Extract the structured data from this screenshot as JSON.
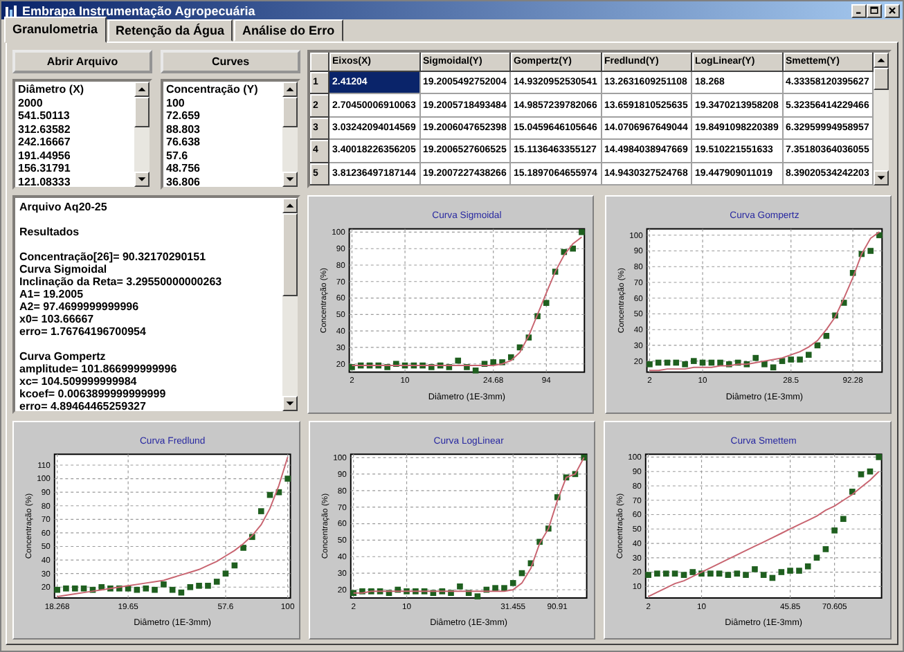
{
  "window": {
    "title": "Embrapa Instrumentação Agropecuária"
  },
  "tabs": [
    {
      "label": "Granulometria",
      "selected": true
    },
    {
      "label": "Retenção da Água",
      "selected": false
    },
    {
      "label": "Análise do Erro",
      "selected": false
    }
  ],
  "buttons": [
    "Abrir Arquivo",
    "Curves"
  ],
  "lists": [
    {
      "header": "Diâmetro (X)",
      "items": [
        "2000",
        "541.50113",
        "312.63582",
        "242.16667",
        "191.44956",
        "156.31791",
        "121.08333"
      ]
    },
    {
      "header": "Concentração (Y)",
      "items": [
        "100",
        "72.659",
        "88.803",
        "76.638",
        "57.6",
        "48.756",
        "36.806"
      ]
    }
  ],
  "table": {
    "columns": [
      "Eixos(X)",
      "Sigmoidal(Y)",
      "Gompertz(Y)",
      "Fredlund(Y)",
      "LogLinear(Y)",
      "Smettem(Y)"
    ],
    "rows": [
      {
        "label": "1",
        "cells": [
          {
            "text": "2.41204",
            "selected": true
          },
          {
            "text": "19.2005492752004",
            "selected": false
          },
          {
            "text": "14.9320952530541",
            "selected": false
          },
          {
            "text": "13.2631609251108",
            "selected": false
          },
          {
            "text": "18.268",
            "selected": false
          },
          {
            "text": "4.33358120395627",
            "selected": false
          }
        ]
      },
      {
        "label": "2",
        "cells": [
          {
            "text": "2.70450006910063",
            "selected": false
          },
          {
            "text": "19.2005718493484",
            "selected": false
          },
          {
            "text": "14.9857239782066",
            "selected": false
          },
          {
            "text": "13.6591810525635",
            "selected": false
          },
          {
            "text": "19.3470213958208",
            "selected": false
          },
          {
            "text": "5.32356414229466",
            "selected": false
          }
        ]
      },
      {
        "label": "3",
        "cells": [
          {
            "text": "3.03242094014569",
            "selected": false
          },
          {
            "text": "19.2006047652398",
            "selected": false
          },
          {
            "text": "15.0459646105646",
            "selected": false
          },
          {
            "text": "14.0706967649044",
            "selected": false
          },
          {
            "text": "19.8491098220389",
            "selected": false
          },
          {
            "text": "6.32959994958957",
            "selected": false
          }
        ]
      },
      {
        "label": "4",
        "cells": [
          {
            "text": "3.40018226356205",
            "selected": false
          },
          {
            "text": "19.2006527606525",
            "selected": false
          },
          {
            "text": "15.1136463355127",
            "selected": false
          },
          {
            "text": "14.4984038947669",
            "selected": false
          },
          {
            "text": "19.510221551633",
            "selected": false
          },
          {
            "text": "7.35180364036055",
            "selected": false
          }
        ]
      },
      {
        "label": "5",
        "cells": [
          {
            "text": "3.81236497187144",
            "selected": false
          },
          {
            "text": "19.2007227438266",
            "selected": false
          },
          {
            "text": "15.1897064655974",
            "selected": false
          },
          {
            "text": "14.9430327524768",
            "selected": false
          },
          {
            "text": "19.447909011019",
            "selected": false
          },
          {
            "text": "8.39020534242203",
            "selected": false
          }
        ]
      }
    ]
  },
  "results": [
    [
      "Arquivo Aq20-25"
    ],
    [
      "Resultados"
    ],
    [
      "Concentração[26]= 90.32170290151",
      "Curva Sigmoidal",
      "Inclinação da Reta= 3.29550000000263",
      "A1= 19.2005",
      "A2= 97.4699999999996",
      "x0= 103.66667",
      "erro= 1.76764196700954"
    ],
    [
      "Curva Gompertz",
      "amplitude= 101.866999999996",
      "xc= 104.509999999984",
      "kcoef= 0.0063899999999999",
      "erro= 4.89464465259327"
    ]
  ],
  "charts": [
    {
      "chart_data": {
        "type": "scatter",
        "title": "Curva Sigmoidal",
        "grid": true,
        "xlabel": "Diâmetro (1E-3mm)",
        "ylabel": "Concentração (%)",
        "categories": [
          "2",
          null,
          null,
          null,
          null,
          null,
          "10",
          null,
          null,
          null,
          null,
          null,
          null,
          null,
          null,
          null,
          "24.68",
          null,
          null,
          null,
          null,
          null,
          "94",
          null,
          null,
          null,
          null
        ],
        "ylim": [
          15,
          102
        ],
        "yticks": [
          20,
          30,
          40,
          50,
          60,
          70,
          80,
          90,
          100
        ],
        "series": [
          {
            "type": "scatter",
            "color": "#1f5f1f",
            "values": [
              18,
              19,
              19,
              19,
              18,
              20,
              19,
              19,
              19,
              18,
              19,
              18,
              22,
              18,
              16,
              20,
              21,
              21,
              24,
              30,
              36,
              49,
              57,
              76,
              88,
              90,
              100
            ]
          },
          {
            "type": "line",
            "color": "#c86470",
            "values": [
              19,
              19,
              19,
              19,
              19,
              19,
              19,
              19,
              19,
              19,
              19,
              19,
              19,
              19,
              19,
              19,
              19,
              20,
              22,
              27,
              37,
              50,
              63,
              76,
              86,
              93,
              97
            ]
          }
        ]
      }
    },
    {
      "chart_data": {
        "type": "scatter",
        "title": "Curva Gompertz",
        "grid": true,
        "xlabel": "Diâmetro (1E-3mm)",
        "ylabel": "Concentração (%)",
        "categories": [
          "2",
          null,
          null,
          null,
          null,
          null,
          "10",
          null,
          null,
          null,
          null,
          null,
          null,
          null,
          null,
          null,
          "28.5",
          null,
          null,
          null,
          null,
          null,
          null,
          "92.28",
          null,
          null,
          null
        ],
        "ylim": [
          13,
          104
        ],
        "yticks": [
          20,
          30,
          40,
          50,
          60,
          70,
          80,
          90,
          100
        ],
        "series": [
          {
            "type": "scatter",
            "color": "#1f5f1f",
            "values": [
              18,
              19,
              19,
              19,
              18,
              20,
              19,
              19,
              19,
              18,
              19,
              18,
              22,
              18,
              16,
              20,
              21,
              21,
              24,
              30,
              36,
              49,
              57,
              76,
              88,
              90,
              100
            ]
          },
          {
            "type": "line",
            "color": "#c86470",
            "values": [
              14,
              14,
              15,
              15,
              15,
              16,
              16,
              16,
              17,
              17,
              18,
              18,
              19,
              20,
              21,
              22,
              24,
              26,
              29,
              33,
              40,
              48,
              60,
              73,
              88,
              98,
              102
            ]
          }
        ]
      }
    },
    {
      "chart_data": {
        "type": "scatter",
        "title": "Curva Fredlund",
        "grid": true,
        "xlabel": "Diâmetro (1E-3mm)",
        "ylabel": "Concentração (%)",
        "categories": [
          "18.268",
          null,
          null,
          null,
          null,
          null,
          null,
          null,
          "19.65",
          null,
          null,
          null,
          null,
          null,
          null,
          null,
          null,
          null,
          null,
          "57.6",
          null,
          null,
          null,
          null,
          null,
          null,
          "100"
        ],
        "ylim": [
          12,
          118
        ],
        "yticks": [
          20,
          30,
          40,
          50,
          60,
          70,
          80,
          90,
          100,
          110
        ],
        "series": [
          {
            "type": "scatter",
            "color": "#1f5f1f",
            "values": [
              18,
              19,
              19,
              19,
              18,
              20,
              19,
              19,
              19,
              18,
              19,
              18,
              22,
              18,
              16,
              20,
              21,
              21,
              24,
              30,
              36,
              49,
              57,
              76,
              88,
              90,
              100
            ]
          },
          {
            "type": "line",
            "color": "#c86470",
            "values": [
              13,
              14,
              15,
              16,
              17,
              18,
              19,
              20,
              21,
              22,
              23,
              24,
              25,
              27,
              29,
              31,
              33,
              36,
              39,
              43,
              47,
              52,
              58,
              66,
              78,
              95,
              116
            ]
          }
        ]
      }
    },
    {
      "chart_data": {
        "type": "scatter",
        "title": "Curva LogLinear",
        "grid": true,
        "xlabel": "Diâmetro (1E-3mm)",
        "ylabel": "Concentração (%)",
        "categories": [
          "2",
          null,
          null,
          null,
          null,
          null,
          "10",
          null,
          null,
          null,
          null,
          null,
          null,
          null,
          null,
          null,
          null,
          null,
          "31.455",
          null,
          null,
          null,
          null,
          "90.91",
          null,
          null,
          null
        ],
        "ylim": [
          15,
          102
        ],
        "yticks": [
          20,
          30,
          40,
          50,
          60,
          70,
          80,
          90,
          100
        ],
        "series": [
          {
            "type": "scatter",
            "color": "#1f5f1f",
            "values": [
              18,
              19,
              19,
              19,
              18,
              20,
              19,
              19,
              19,
              18,
              19,
              18,
              22,
              18,
              16,
              20,
              21,
              21,
              24,
              30,
              36,
              49,
              57,
              76,
              88,
              90,
              100
            ]
          },
          {
            "type": "line",
            "color": "#c86470",
            "values": [
              18,
              18,
              19,
              19,
              19,
              19,
              19,
              19,
              19,
              19,
              19,
              19,
              19,
              19,
              19,
              19,
              19,
              19,
              20,
              24,
              33,
              48,
              57,
              74,
              88,
              90,
              100
            ]
          }
        ]
      }
    },
    {
      "chart_data": {
        "type": "scatter",
        "title": "Curva Smettem",
        "grid": true,
        "xlabel": "Diâmetro (1E-3mm)",
        "ylabel": "Concentração (%)",
        "categories": [
          "2",
          null,
          null,
          null,
          null,
          null,
          "10",
          null,
          null,
          null,
          null,
          null,
          null,
          null,
          null,
          null,
          "45.85",
          null,
          null,
          null,
          null,
          "70.605",
          null,
          null,
          null,
          null,
          null
        ],
        "ylim": [
          2,
          102
        ],
        "yticks": [
          10,
          20,
          30,
          40,
          50,
          60,
          70,
          80,
          90,
          100
        ],
        "series": [
          {
            "type": "scatter",
            "color": "#1f5f1f",
            "values": [
              18,
              19,
              19,
              19,
              18,
              20,
              19,
              19,
              19,
              18,
              19,
              18,
              22,
              18,
              16,
              20,
              21,
              21,
              24,
              30,
              36,
              49,
              57,
              76,
              88,
              90,
              100
            ]
          },
          {
            "type": "line",
            "color": "#c86470",
            "values": [
              3,
              6,
              9,
              12,
              14,
              17,
              20,
              23,
              26,
              29,
              32,
              35,
              38,
              41,
              44,
              47,
              50,
              53,
              56,
              59,
              63,
              66,
              70,
              74,
              79,
              84,
              90
            ]
          }
        ]
      }
    }
  ]
}
